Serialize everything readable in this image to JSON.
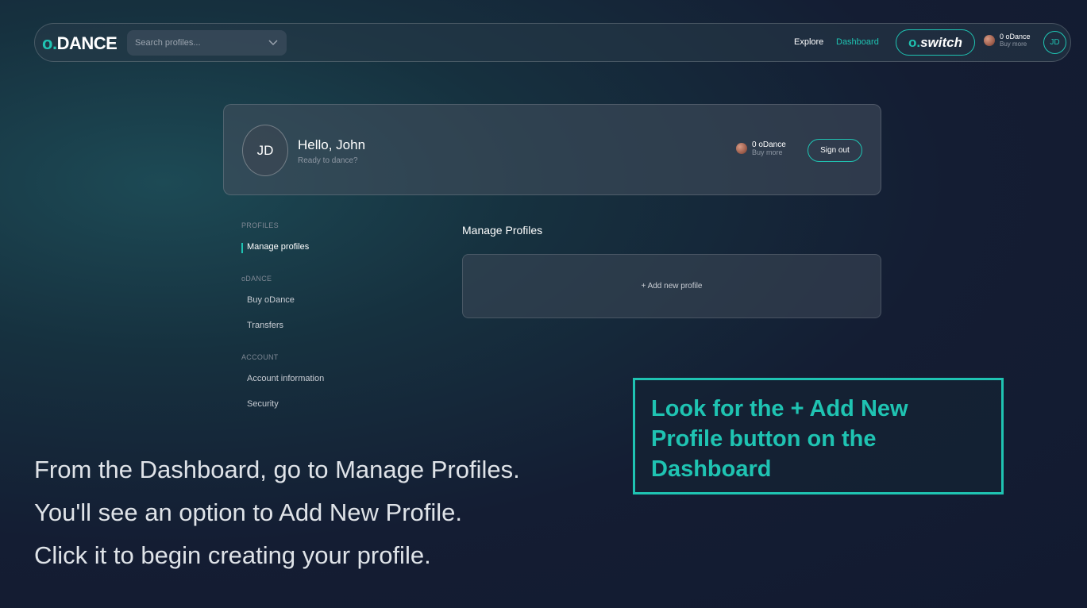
{
  "app": {
    "logo_prefix": "o",
    "logo_dot": ".",
    "logo_text": "DANCE"
  },
  "topbar": {
    "search_placeholder": "Search profiles...",
    "nav": [
      {
        "label": "Explore"
      },
      {
        "label": "Dashboard",
        "active": true
      }
    ],
    "switch_prefix": "o.",
    "switch_text": "switch",
    "balance_amount": "0 oDance",
    "balance_buy": "Buy more",
    "avatar_initials": "JD"
  },
  "profile": {
    "initials": "JD",
    "greeting": "Hello, John",
    "subtitle": "Ready to dance?",
    "balance_amount": "0 oDance",
    "balance_buy": "Buy more",
    "signout_label": "Sign out"
  },
  "sidebar": {
    "sections": [
      {
        "heading": "PROFILES",
        "items": [
          {
            "label": "Manage profiles",
            "active": true
          }
        ]
      },
      {
        "heading": "oDANCE",
        "items": [
          {
            "label": "Buy oDance"
          },
          {
            "label": "Transfers"
          }
        ]
      },
      {
        "heading": "ACCOUNT",
        "items": [
          {
            "label": "Account information"
          },
          {
            "label": "Security"
          }
        ]
      }
    ]
  },
  "main": {
    "title": "Manage Profiles",
    "add_profile_label": "+ Add new profile"
  },
  "callout": {
    "text": "Look for the + Add New Profile button on the Dashboard"
  },
  "instructions": [
    "From the Dashboard, go to Manage Profiles.",
    "You'll see an option to Add New Profile.",
    "Click it to begin creating your profile."
  ],
  "colors": {
    "accent": "#1fc3b2",
    "background": "#141d33"
  }
}
